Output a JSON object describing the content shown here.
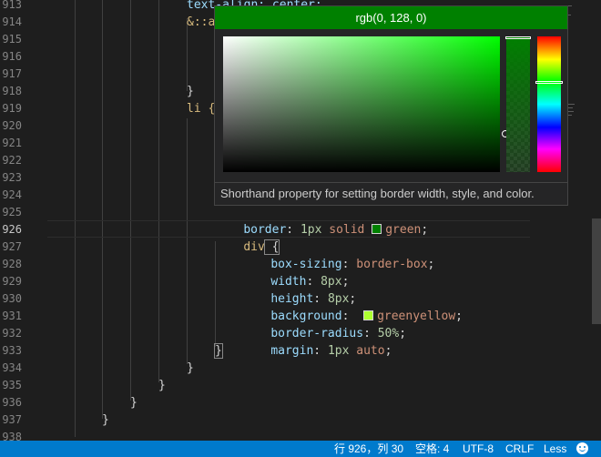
{
  "editor": {
    "line_numbers": [
      "913",
      "914",
      "915",
      "916",
      "917",
      "918",
      "919",
      "920",
      "921",
      "922",
      "923",
      "924",
      "925",
      "926",
      "927",
      "928",
      "929",
      "930",
      "931",
      "932",
      "933",
      "934",
      "935",
      "936",
      "937",
      "938"
    ],
    "active_line": "926",
    "lines": {
      "l913": {
        "text": "text-align: center;"
      },
      "l914": {
        "text": "&::a"
      },
      "l918": {
        "text": "}"
      },
      "l919": {
        "text": "li {"
      },
      "l925": {
        "prop": "border",
        "colon": ": ",
        "num": "1px",
        "val": " solid ",
        "color_word": "green",
        "semi": ";"
      },
      "l926": {
        "sel": "div",
        "brace": " {"
      },
      "l927": {
        "prop": "box-sizing",
        "colon": ": ",
        "val": "border-box",
        "semi": ";"
      },
      "l928": {
        "prop": "width",
        "colon": ": ",
        "num": "8px",
        "semi": ";"
      },
      "l929": {
        "prop": "height",
        "colon": ": ",
        "num": "8px",
        "semi": ";"
      },
      "l930": {
        "prop": "background",
        "colon": ":  ",
        "color_word": "greenyellow",
        "semi": ";"
      },
      "l931": {
        "prop": "border-radius",
        "colon": ": ",
        "num": "50%",
        "semi": ";"
      },
      "l932": {
        "prop": "margin",
        "colon": ": ",
        "num": "1px",
        "val": " auto",
        "semi": ";"
      },
      "l933": {
        "text": "}"
      },
      "l934": {
        "text": "}"
      },
      "l935": {
        "text": "}"
      },
      "l936": {
        "text": "}"
      },
      "l937": {
        "text": "}"
      }
    },
    "colors": {
      "green_swatch": "#008000",
      "greenyellow_swatch": "#adff2f"
    }
  },
  "picker": {
    "color_label": "rgb(0, 128, 0)",
    "header_color": "#008000",
    "description": "Shorthand property for setting border width, style, and color."
  },
  "statusbar": {
    "position": "行 926，列 30",
    "indent": "空格: 4",
    "encoding": "UTF-8",
    "eol": "CRLF",
    "language": "Less",
    "feedback_icon": "smiley-icon"
  }
}
